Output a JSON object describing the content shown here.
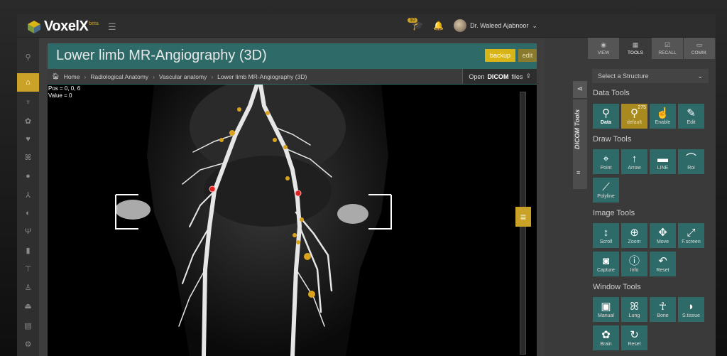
{
  "app": {
    "logo_text": "VoxelX",
    "logo_sub": "beta"
  },
  "topbar": {
    "notif_count": "10",
    "user_name": "Dr. Waleed Ajabnoor"
  },
  "leftbar": {
    "items": [
      "search-icon",
      "home-icon",
      "tooth-icon",
      "brain-icon",
      "heart-icon",
      "lung-icon",
      "liver-icon",
      "pelvis-icon",
      "stomach-icon",
      "uterus-icon",
      "spine-icon",
      "mushroom-icon",
      "figure-icon",
      "hand-icon",
      "list-icon",
      "settings-icon"
    ]
  },
  "page": {
    "title": "Lower limb MR-Angiography (3D)",
    "backup_label": "backup",
    "edit_label": "edit",
    "breadcrumb": [
      "Home",
      "Radiological Anatomy",
      "Vascular anatomy",
      "Lower limb MR-Angiography (3D)"
    ],
    "dicom_prefix": "Open",
    "dicom_bold": "DICOM",
    "dicom_suffix": "files",
    "pos_text": "Pos = 0, 0, 6",
    "value_text": "Value = 0"
  },
  "strip": {
    "dicom_label": "DICOM Tools"
  },
  "right_panel": {
    "tabs": [
      {
        "label": "VIEW",
        "active": false
      },
      {
        "label": "TOOLS",
        "active": true
      },
      {
        "label": "RECALL",
        "active": false
      },
      {
        "label": "COMM.",
        "active": false
      }
    ],
    "select_placeholder": "Select a Structure",
    "groups": {
      "data": {
        "title": "Data Tools",
        "tools": [
          {
            "label": "Data",
            "bold": true
          },
          {
            "label": "default",
            "badge": "275",
            "gold": true
          },
          {
            "label": "Enable"
          },
          {
            "label": "Edit"
          }
        ]
      },
      "draw": {
        "title": "Draw Tools",
        "tools": [
          {
            "label": "Point"
          },
          {
            "label": "Arrow"
          },
          {
            "label": "LINE"
          },
          {
            "label": "Roi"
          },
          {
            "label": "Polyline"
          }
        ]
      },
      "image": {
        "title": "Image Tools",
        "tools": [
          {
            "label": "Scroll"
          },
          {
            "label": "Zoom"
          },
          {
            "label": "Move"
          },
          {
            "label": "F.screen"
          },
          {
            "label": "Capture"
          },
          {
            "label": "Info"
          },
          {
            "label": "Reset"
          }
        ]
      },
      "window": {
        "title": "Window Tools",
        "tools": [
          {
            "label": "Manual"
          },
          {
            "label": "Lung"
          },
          {
            "label": "Bone"
          },
          {
            "label": "S.tissue"
          },
          {
            "label": "Brain"
          },
          {
            "label": "Reset"
          }
        ]
      }
    }
  },
  "colors": {
    "accent": "#c9a227",
    "panel_teal": "#2e6a68",
    "marker_red": "#e02020",
    "marker_gold": "#d9a31f"
  }
}
